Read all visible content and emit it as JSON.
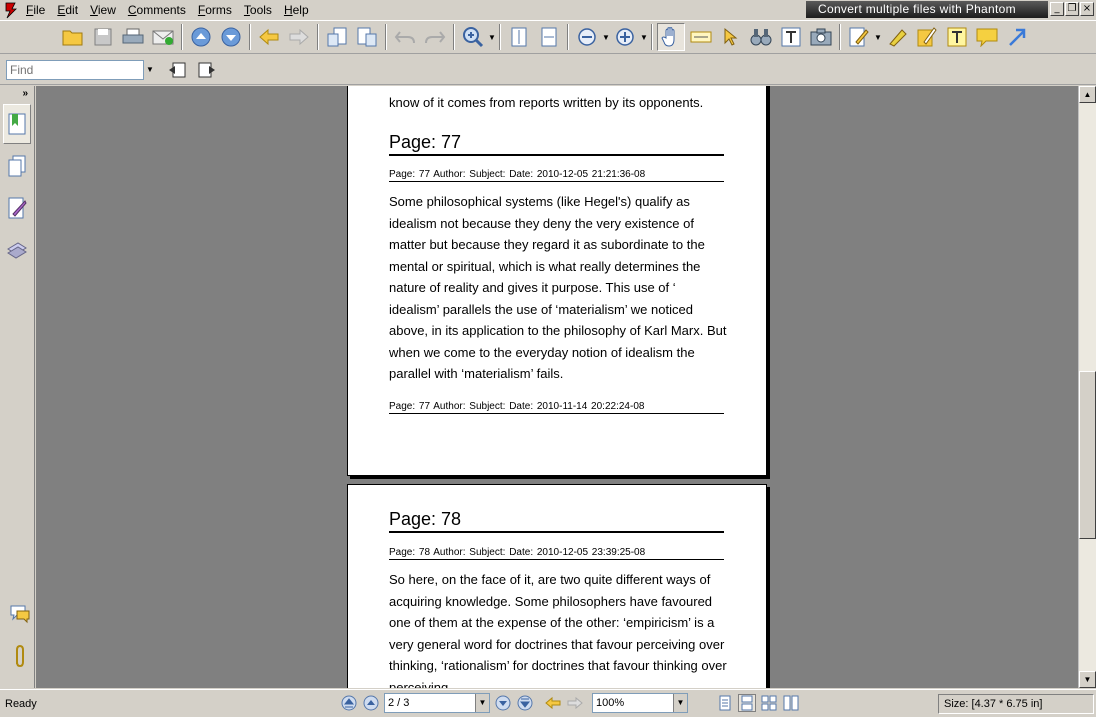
{
  "menubar": {
    "items": [
      {
        "label": "File",
        "u": "F",
        "rest": "ile"
      },
      {
        "label": "Edit",
        "u": "E",
        "rest": "dit"
      },
      {
        "label": "View",
        "u": "V",
        "rest": "iew"
      },
      {
        "label": "Comments",
        "u": "C",
        "rest": "omments"
      },
      {
        "label": "Forms",
        "u": "F",
        "rest": "orms"
      },
      {
        "label": "Tools",
        "u": "T",
        "rest": "ools"
      },
      {
        "label": "Help",
        "u": "H",
        "rest": "elp"
      }
    ],
    "banner": "Convert multiple files with Phantom"
  },
  "find": {
    "placeholder": "Find"
  },
  "document": {
    "page1_tail": "know of it comes from reports written by its opponents.",
    "page77": {
      "title": "Page: 77",
      "meta1": "Page: 77   Author:    Subject:     Date: 2010-12-05 21:21:36-08",
      "body": "Some philosophical systems (like Hegel's) qualify as idealism not because they deny the very existence of matter but because they regard it as subordinate to the mental or spiritual, which is what really determines the nature of reality and gives it purpose. This use of ‘ idealism’ parallels the use of ‘materialism’ we noticed above, in its application to the philosophy of Karl Marx. But when we come to the everyday notion of idealism the parallel with ‘materialism’ fails.",
      "meta2": "Page: 77   Author:    Subject:     Date: 2010-11-14 20:22:24-08"
    },
    "page78": {
      "title": "Page: 78",
      "meta1": "Page: 78   Author:    Subject:     Date: 2010-12-05 23:39:25-08",
      "body": "So here, on the face of it, are two quite different ways of acquiring knowledge. Some philosophers have favoured one of them at the expense of the other: ‘empiricism’ is a very general word for doctrines that favour perceiving over thinking, ‘rationalism’ for doctrines that favour thinking over perceiving."
    }
  },
  "status": {
    "ready": "Ready",
    "page_indicator": "2 / 3",
    "zoom": "100%",
    "size": "Size: [4.37 * 6.75 in]"
  }
}
